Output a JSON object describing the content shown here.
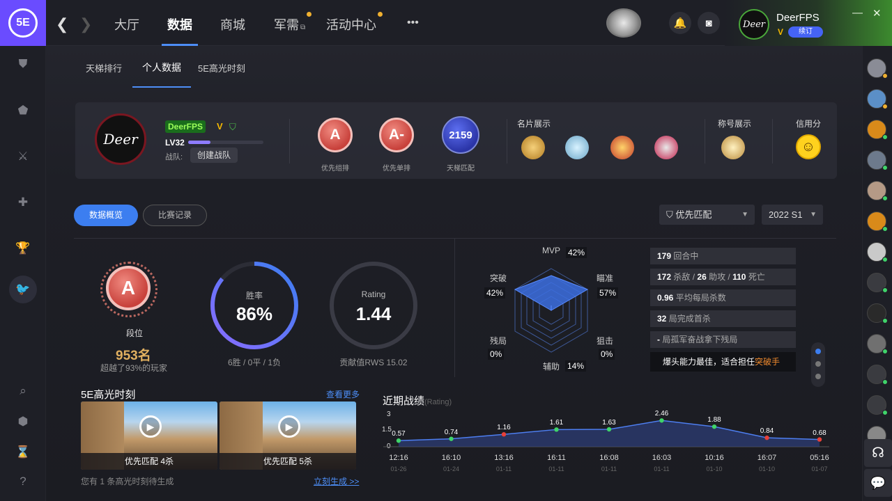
{
  "topbar": {
    "logo_text": "5E",
    "back_glyph": "❮",
    "forward_glyph": "❯",
    "tabs": [
      "大厅",
      "数据",
      "商城",
      "军需",
      "活动中心"
    ],
    "more_glyph": "•••",
    "user": {
      "name": "DeerFPS",
      "vip": "V",
      "renew": "续订",
      "avatar_text": "Deer"
    },
    "window": {
      "minimize": "—",
      "close": "✕"
    }
  },
  "subtabs": [
    "天梯排行",
    "个人数据",
    "5E高光时刻"
  ],
  "profile": {
    "avatar_text": "Deer",
    "name_tag": "DeerFPS",
    "vip": "V",
    "level": "LV32",
    "level_progress": 0.3,
    "team_label": "战队:",
    "team_button": "创建战队",
    "ranks": [
      {
        "grade": "A",
        "label": "优先组排"
      },
      {
        "grade": "A-",
        "label": "优先单排"
      }
    ],
    "ladder": {
      "score": "2159",
      "label": "天梯匹配"
    },
    "card_title": "名片展示",
    "title_title": "称号展示",
    "credit_title": "信用分"
  },
  "filters": {
    "overview": "数据概览",
    "records": "比赛记录",
    "mode": "优先匹配",
    "season": "2022 S1"
  },
  "summary": {
    "grade": "A",
    "grade_label": "段位",
    "position": "953名",
    "beat": "超越了93%的玩家",
    "winrate_label": "胜率",
    "winrate": "86%",
    "winrate_value": 0.86,
    "record": "6胜 / 0平 / 1负",
    "rating_label": "Rating",
    "rating": "1.44",
    "rws": "贡献值RWS 15.02"
  },
  "radar": {
    "labels": [
      {
        "name": "MVP",
        "value": "42%"
      },
      {
        "name": "瞄准",
        "value": "57%"
      },
      {
        "name": "狙击",
        "value": "0%"
      },
      {
        "name": "辅助",
        "value": "14%"
      },
      {
        "name": "残局",
        "value": "0%"
      },
      {
        "name": "突破",
        "value": "42%"
      }
    ]
  },
  "stats": [
    {
      "num": "179",
      "text": "回合中"
    },
    {
      "num": "172",
      "text": "杀敌 / ",
      "num2": "26",
      "text2": "助攻 / ",
      "num3": "110",
      "text3": "死亡"
    },
    {
      "num": "0.96",
      "text": "平均每局杀数"
    },
    {
      "num": "32",
      "text": "局完成首杀"
    },
    {
      "num": "-",
      "text": "局孤军奋战拿下残局"
    }
  ],
  "stat_summary": {
    "text": "爆头能力最佳，适合担任",
    "role": "突破手"
  },
  "highlights": {
    "title": "5E高光时刻",
    "more": "查看更多",
    "clips": [
      {
        "caption": "优先匹配 4杀"
      },
      {
        "caption": "优先匹配 5杀"
      }
    ],
    "note": "您有 1 条高光时刻待生成",
    "generate": "立刻生成 >>"
  },
  "recent": {
    "title": "近期战绩",
    "subtitle": "(Rating)",
    "yticks": [
      "3",
      "1.5",
      "0"
    ]
  },
  "chart_data": {
    "type": "area",
    "title": "近期战绩",
    "ylabel": "Rating",
    "ylim": [
      0,
      3
    ],
    "x": [
      "12:16",
      "16:10",
      "13:16",
      "16:11",
      "16:08",
      "16:03",
      "10:16",
      "16:07",
      "05:16"
    ],
    "dates": [
      "01-26",
      "01-24",
      "01-11",
      "01-11",
      "01-11",
      "01-11",
      "01-10",
      "01-10",
      "01-07"
    ],
    "series": [
      {
        "values": [
          0.57,
          0.74,
          1.16,
          1.61,
          1.63,
          2.46,
          1.88,
          0.84,
          0.68
        ]
      }
    ],
    "point_colors": [
      "#3fd46a",
      "#3fd46a",
      "#e8403a",
      "#3fd46a",
      "#3fd46a",
      "#3fd46a",
      "#3fd46a",
      "#e8403a",
      "#e8403a"
    ],
    "grid": false
  },
  "colors": {
    "accent": "#3c7ef0",
    "rank_red": "#c8413b",
    "gold": "#e0b060"
  }
}
